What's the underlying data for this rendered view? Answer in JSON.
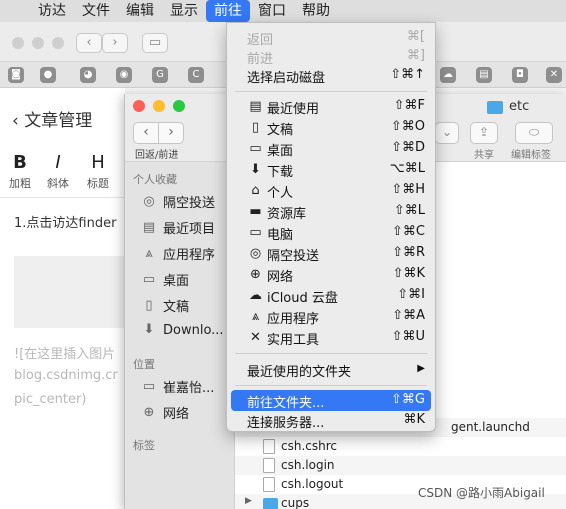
{
  "menubar": {
    "items": [
      "访达",
      "文件",
      "编辑",
      "显示",
      "前往",
      "窗口",
      "帮助"
    ],
    "active": "前往"
  },
  "article": {
    "back_title": "文章管理",
    "format": [
      {
        "glyph": "B",
        "label": "加粗"
      },
      {
        "glyph": "I",
        "label": "斜体"
      },
      {
        "glyph": "H",
        "label": "标题"
      }
    ],
    "line1": "1.点击访达finder",
    "faint1": "![在这里插入图片",
    "faint2": "blog.csdnimg.cr",
    "faint3": "pic_center)"
  },
  "finder": {
    "title": "etc",
    "nav_label": "回返/前进",
    "share_label": "共享",
    "edit_tags_label": "编辑标签",
    "sidebar": {
      "favorites_header": "个人收藏",
      "favorites": [
        {
          "icon": "airdrop-icon",
          "label": "隔空投送"
        },
        {
          "icon": "recents-icon",
          "label": "最近项目"
        },
        {
          "icon": "applications-icon",
          "label": "应用程序"
        },
        {
          "icon": "desktop-icon",
          "label": "桌面"
        },
        {
          "icon": "documents-icon",
          "label": "文稿"
        },
        {
          "icon": "downloads-icon",
          "label": "Downlo..."
        }
      ],
      "locations_header": "位置",
      "locations": [
        {
          "icon": "computer-icon",
          "label": "崔嘉怡..."
        },
        {
          "icon": "network-icon",
          "label": "网络"
        }
      ],
      "tags_header": "标签"
    },
    "files": [
      {
        "name": "gent.launchd",
        "kind": "file"
      },
      {
        "name": "csh.cshrc",
        "kind": "file"
      },
      {
        "name": "csh.login",
        "kind": "file"
      },
      {
        "name": "csh.logout",
        "kind": "file"
      },
      {
        "name": "cups",
        "kind": "folder"
      }
    ]
  },
  "go_menu": {
    "items": [
      {
        "label": "返回",
        "shortcut": "⌘[",
        "disabled": true
      },
      {
        "label": "前进",
        "shortcut": "⌘]",
        "disabled": true
      },
      {
        "label": "选择启动磁盘",
        "shortcut": "⇧⌘↑"
      },
      {
        "label": "最近使用",
        "shortcut": "⇧⌘F",
        "icon": "recents-icon"
      },
      {
        "label": "文稿",
        "shortcut": "⇧⌘O",
        "icon": "documents-icon"
      },
      {
        "label": "桌面",
        "shortcut": "⇧⌘D",
        "icon": "desktop-icon"
      },
      {
        "label": "下载",
        "shortcut": "⌥⌘L",
        "icon": "downloads-icon"
      },
      {
        "label": "个人",
        "shortcut": "⇧⌘H",
        "icon": "home-icon"
      },
      {
        "label": "资源库",
        "shortcut": "⇧⌘L",
        "icon": "library-icon"
      },
      {
        "label": "电脑",
        "shortcut": "⇧⌘C",
        "icon": "computer-icon"
      },
      {
        "label": "隔空投送",
        "shortcut": "⇧⌘R",
        "icon": "airdrop-icon"
      },
      {
        "label": "网络",
        "shortcut": "⇧⌘K",
        "icon": "network-icon"
      },
      {
        "label": "iCloud 云盘",
        "shortcut": "⇧⌘I",
        "icon": "icloud-icon"
      },
      {
        "label": "应用程序",
        "shortcut": "⇧⌘A",
        "icon": "applications-icon"
      },
      {
        "label": "实用工具",
        "shortcut": "⇧⌘U",
        "icon": "utilities-icon"
      },
      {
        "label": "最近使用的文件夹",
        "shortcut": "▶"
      },
      {
        "label": "前往文件夹...",
        "shortcut": "⇧⌘G",
        "highlighted": true
      },
      {
        "label": "连接服务器...",
        "shortcut": "⌘K"
      }
    ]
  },
  "watermark": "CSDN @路小雨Abigail",
  "colors": {
    "accent": "#3478f6",
    "folder": "#4aa8e8",
    "close": "#fe5f57",
    "minimize": "#febc2e",
    "zoom": "#28c840"
  }
}
